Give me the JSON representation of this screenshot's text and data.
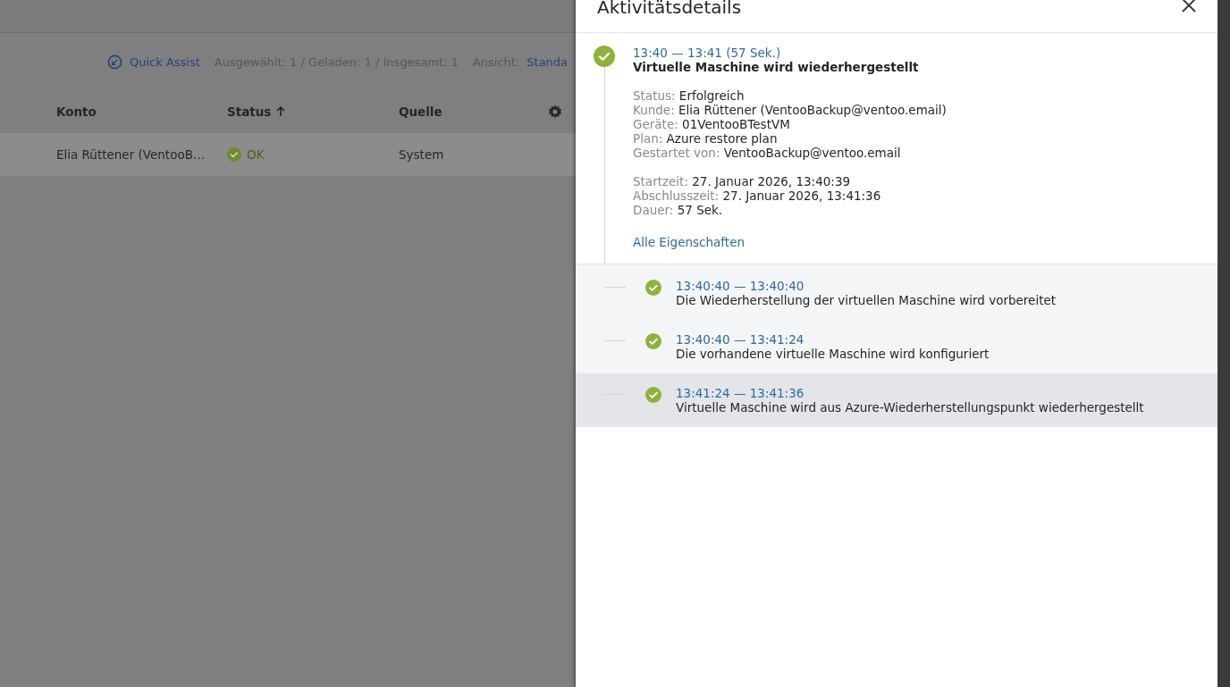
{
  "background": {
    "toolbar": {
      "quick_assist": "Quick Assist",
      "counts": "Ausgewählt: 1 / Geladen: 1 / Insgesamt: 1",
      "view_label": "Ansicht:",
      "view_value": "Standa"
    },
    "table": {
      "columns": [
        {
          "label": "Konto",
          "sorted": false
        },
        {
          "label": "Status",
          "sorted": true
        },
        {
          "label": "Quelle",
          "sorted": false
        }
      ],
      "rows": [
        {
          "selected": true,
          "cells": [
            "Elia Rüttener (VentooB…",
            "OK",
            "System"
          ],
          "kind": "success"
        }
      ]
    }
  },
  "panel": {
    "title": "Aktivitätsdetails",
    "activity": {
      "time": "13:40 — 13:41 (57 Sek.)",
      "title": "Virtuelle Maschine wird wiederhergestellt",
      "kind": "success",
      "groups": [
        [
          {
            "label": "Status:",
            "value": "Erfolgreich"
          },
          {
            "label": "Kunde:",
            "value": "Elia Rüttener (VentooBackup@ventoo.email)"
          },
          {
            "label": "Geräte:",
            "value": "01VentooBTestVM"
          },
          {
            "label": "Plan:",
            "value": "Azure restore plan"
          },
          {
            "label": "Gestartet von:",
            "value": "VentooBackup@ventoo.email"
          }
        ],
        [
          {
            "label": "Startzeit:",
            "value": "27. Januar 2026, 13:40:39"
          },
          {
            "label": "Abschlusszeit:",
            "value": "27. Januar 2026, 13:41:36"
          },
          {
            "label": "Dauer:",
            "value": "57 Sek."
          }
        ]
      ],
      "link": "Alle Eigenschaften"
    },
    "steps": [
      {
        "time": "13:40:40 — 13:40:40",
        "text": "Die Wiederherstellung der virtuellen Maschine wird vorbereitet",
        "kind": "success",
        "hovered": false
      },
      {
        "time": "13:40:40 — 13:41:24",
        "text": "Die vorhandene virtuelle Maschine wird konfiguriert",
        "kind": "success",
        "hovered": false
      },
      {
        "time": "13:41:24 — 13:41:36",
        "text": "Virtuelle Maschine wird aus Azure-Wiederherstellungspunkt wiederhergestellt",
        "kind": "success",
        "hovered": true
      }
    ]
  }
}
